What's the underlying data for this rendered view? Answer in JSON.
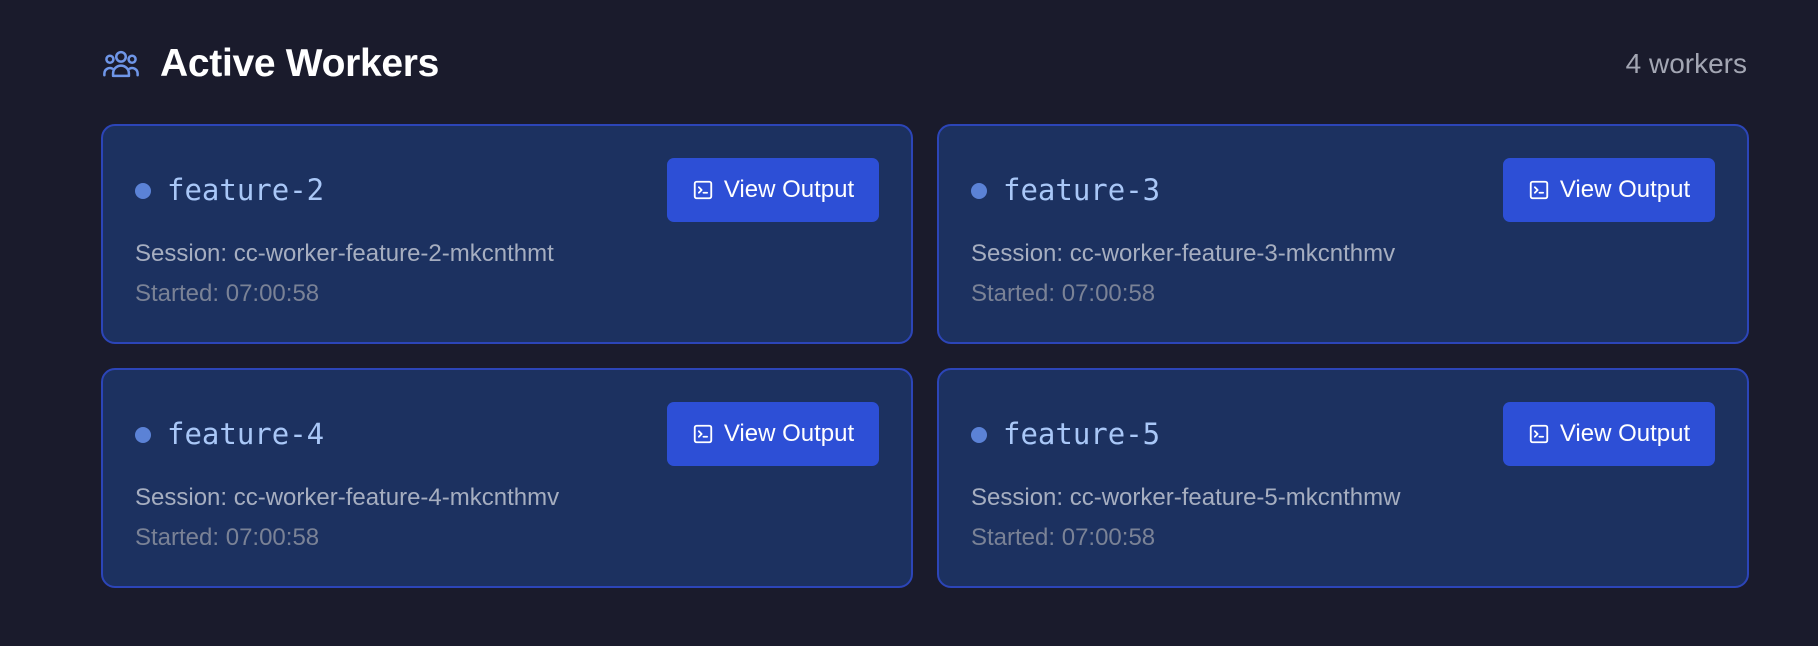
{
  "header": {
    "title": "Active Workers",
    "count_label": "4 workers",
    "icon": "users-icon"
  },
  "colors": {
    "background": "#1a1b2c",
    "card_background": "#1c3160",
    "card_border": "#2c45b8",
    "button": "#2d4fd6",
    "status_dot": "#5b82d6",
    "accent_icon": "#6f96e8"
  },
  "workers": [
    {
      "name": "feature-2",
      "session": "Session: cc-worker-feature-2-mkcnthmt",
      "started": "Started: 07:00:58",
      "button_label": "View Output",
      "button_icon": "terminal-icon"
    },
    {
      "name": "feature-3",
      "session": "Session: cc-worker-feature-3-mkcnthmv",
      "started": "Started: 07:00:58",
      "button_label": "View Output",
      "button_icon": "terminal-icon"
    },
    {
      "name": "feature-4",
      "session": "Session: cc-worker-feature-4-mkcnthmv",
      "started": "Started: 07:00:58",
      "button_label": "View Output",
      "button_icon": "terminal-icon"
    },
    {
      "name": "feature-5",
      "session": "Session: cc-worker-feature-5-mkcnthmw",
      "started": "Started: 07:00:58",
      "button_label": "View Output",
      "button_icon": "terminal-icon"
    }
  ]
}
